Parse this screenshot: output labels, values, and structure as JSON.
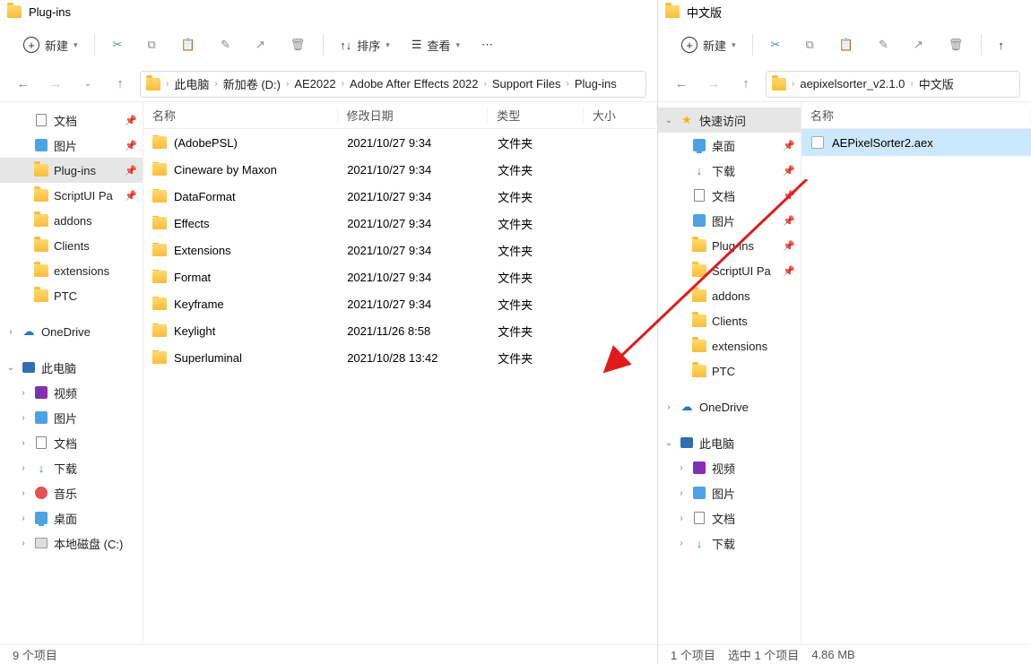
{
  "left": {
    "title": "Plug-ins",
    "toolbar": {
      "newLabel": "新建",
      "sortLabel": "排序",
      "viewLabel": "查看"
    },
    "breadcrumbs": [
      "此电脑",
      "新加卷 (D:)",
      "AE2022",
      "Adobe After Effects 2022",
      "Support Files",
      "Plug-ins"
    ],
    "columns": {
      "name": "名称",
      "date": "修改日期",
      "type": "类型",
      "size": "大小"
    },
    "tree": {
      "quick": [
        {
          "label": "文档",
          "icon": "doc",
          "pin": true
        },
        {
          "label": "图片",
          "icon": "blue",
          "pin": true
        },
        {
          "label": "Plug-ins",
          "icon": "folder",
          "pin": true,
          "sel": true
        },
        {
          "label": "ScriptUI Pa",
          "icon": "folder",
          "pin": true
        },
        {
          "label": "addons",
          "icon": "folder"
        },
        {
          "label": "Clients",
          "icon": "folder"
        },
        {
          "label": "extensions",
          "icon": "folder"
        },
        {
          "label": "PTC",
          "icon": "folder"
        }
      ],
      "onedrive": "OneDrive",
      "pc": "此电脑",
      "pcChildren": [
        {
          "label": "视频",
          "icon": "vid"
        },
        {
          "label": "图片",
          "icon": "blue"
        },
        {
          "label": "文档",
          "icon": "doc"
        },
        {
          "label": "下载",
          "icon": "dl"
        },
        {
          "label": "音乐",
          "icon": "mus"
        },
        {
          "label": "桌面",
          "icon": "desk"
        },
        {
          "label": "本地磁盘 (C:)",
          "icon": "disk"
        }
      ]
    },
    "files": [
      {
        "name": "(AdobePSL)",
        "date": "2021/10/27 9:34",
        "type": "文件夹"
      },
      {
        "name": "Cineware by Maxon",
        "date": "2021/10/27 9:34",
        "type": "文件夹"
      },
      {
        "name": "DataFormat",
        "date": "2021/10/27 9:34",
        "type": "文件夹"
      },
      {
        "name": "Effects",
        "date": "2021/10/27 9:34",
        "type": "文件夹"
      },
      {
        "name": "Extensions",
        "date": "2021/10/27 9:34",
        "type": "文件夹"
      },
      {
        "name": "Format",
        "date": "2021/10/27 9:34",
        "type": "文件夹"
      },
      {
        "name": "Keyframe",
        "date": "2021/10/27 9:34",
        "type": "文件夹"
      },
      {
        "name": "Keylight",
        "date": "2021/11/26 8:58",
        "type": "文件夹"
      },
      {
        "name": "Superluminal",
        "date": "2021/10/28 13:42",
        "type": "文件夹"
      }
    ],
    "status": "9 个项目"
  },
  "right": {
    "title": "中文版",
    "toolbar": {
      "newLabel": "新建"
    },
    "breadcrumbs": [
      "aepixelsorter_v2.1.0",
      "中文版"
    ],
    "columns": {
      "name": "名称"
    },
    "tree": {
      "quickLabel": "快速访问",
      "quick": [
        {
          "label": "桌面",
          "icon": "desk",
          "pin": true
        },
        {
          "label": "下载",
          "icon": "dl",
          "pin": true
        },
        {
          "label": "文档",
          "icon": "doc",
          "pin": true
        },
        {
          "label": "图片",
          "icon": "blue",
          "pin": true
        },
        {
          "label": "Plug-ins",
          "icon": "folder",
          "pin": true
        },
        {
          "label": "ScriptUI Pa",
          "icon": "folder",
          "pin": true
        },
        {
          "label": "addons",
          "icon": "folder"
        },
        {
          "label": "Clients",
          "icon": "folder"
        },
        {
          "label": "extensions",
          "icon": "folder"
        },
        {
          "label": "PTC",
          "icon": "folder"
        }
      ],
      "onedrive": "OneDrive",
      "pc": "此电脑",
      "pcChildren": [
        {
          "label": "视频",
          "icon": "vid"
        },
        {
          "label": "图片",
          "icon": "blue"
        },
        {
          "label": "文档",
          "icon": "doc"
        },
        {
          "label": "下载",
          "icon": "dl"
        }
      ]
    },
    "files": [
      {
        "name": "AEPixelSorter2.aex",
        "icon": "aex",
        "sel": true
      }
    ],
    "status": {
      "count": "1 个项目",
      "sel": "选中 1 个项目",
      "size": "4.86 MB"
    }
  }
}
